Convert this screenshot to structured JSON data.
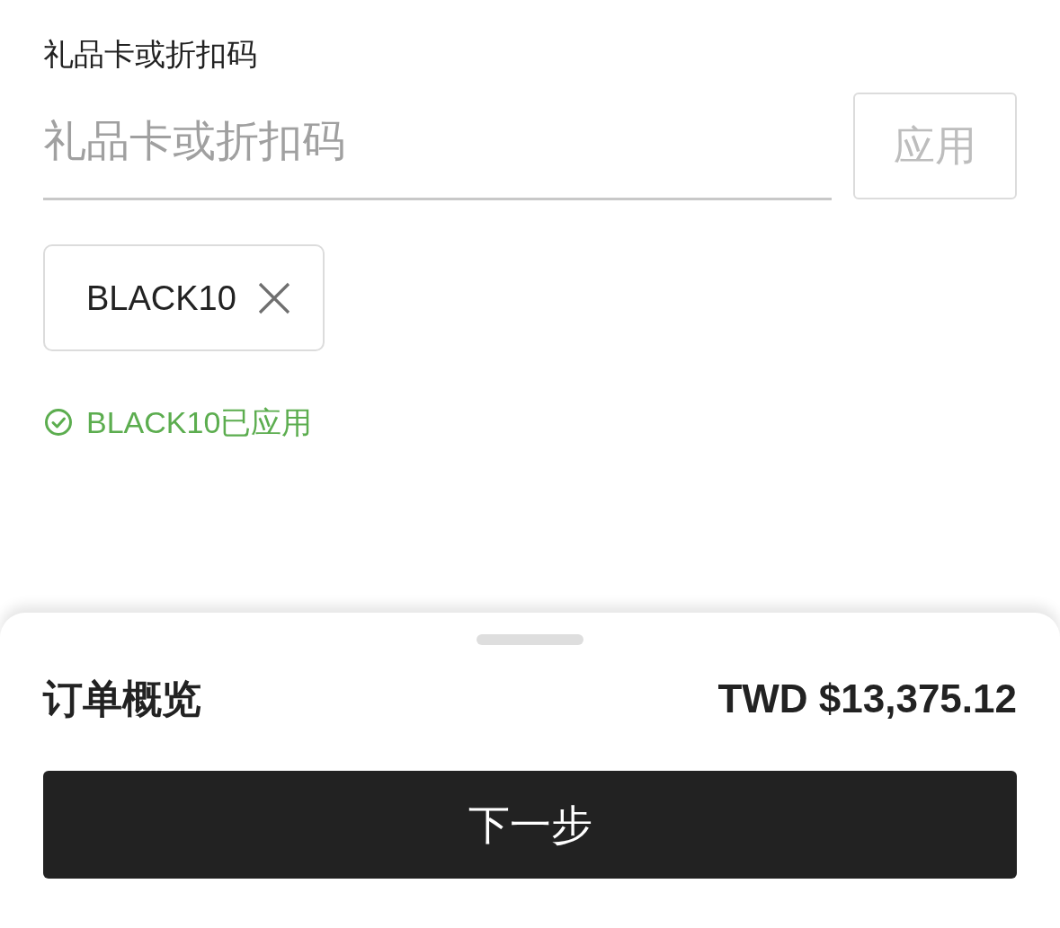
{
  "gift_code": {
    "label": "礼品卡或折扣码",
    "placeholder": "礼品卡或折扣码",
    "apply_button": {
      "label": "应用",
      "disabled": true
    }
  },
  "applied_codes": [
    {
      "code": "BLACK10"
    }
  ],
  "status_message": {
    "kind": "success",
    "text": "BLACK10已应用"
  },
  "order_summary": {
    "title": "订单概览",
    "total": "TWD $13,375.12"
  },
  "next_button": {
    "label": "下一步"
  }
}
